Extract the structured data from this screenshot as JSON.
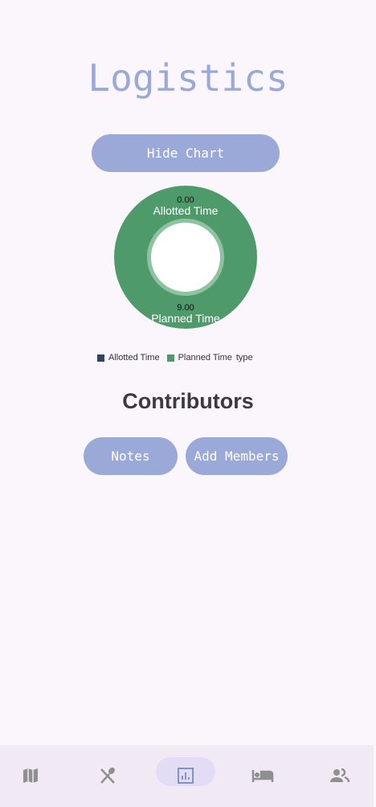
{
  "page": {
    "title": "Logistics",
    "hide_chart_label": "Hide Chart",
    "contributors_heading": "Contributors",
    "notes_label": "Notes",
    "add_members_label": "Add Members"
  },
  "chart_data": {
    "type": "pie",
    "donut": true,
    "categories": [
      "Allotted Time",
      "Planned Time"
    ],
    "values": [
      0,
      9
    ],
    "value_labels": [
      "0.00",
      "9.00"
    ],
    "colors": [
      "#2e4470",
      "#4f9a6b"
    ],
    "legend": {
      "entries": [
        "Allotted Time",
        "Planned Time"
      ],
      "suffix": "type",
      "placement": "bottom"
    }
  },
  "nav": {
    "items": [
      {
        "icon": "map-icon"
      },
      {
        "icon": "restaurant-icon"
      },
      {
        "icon": "bar-chart-icon",
        "active": true
      },
      {
        "icon": "hotel-icon"
      },
      {
        "icon": "group-icon"
      }
    ]
  }
}
